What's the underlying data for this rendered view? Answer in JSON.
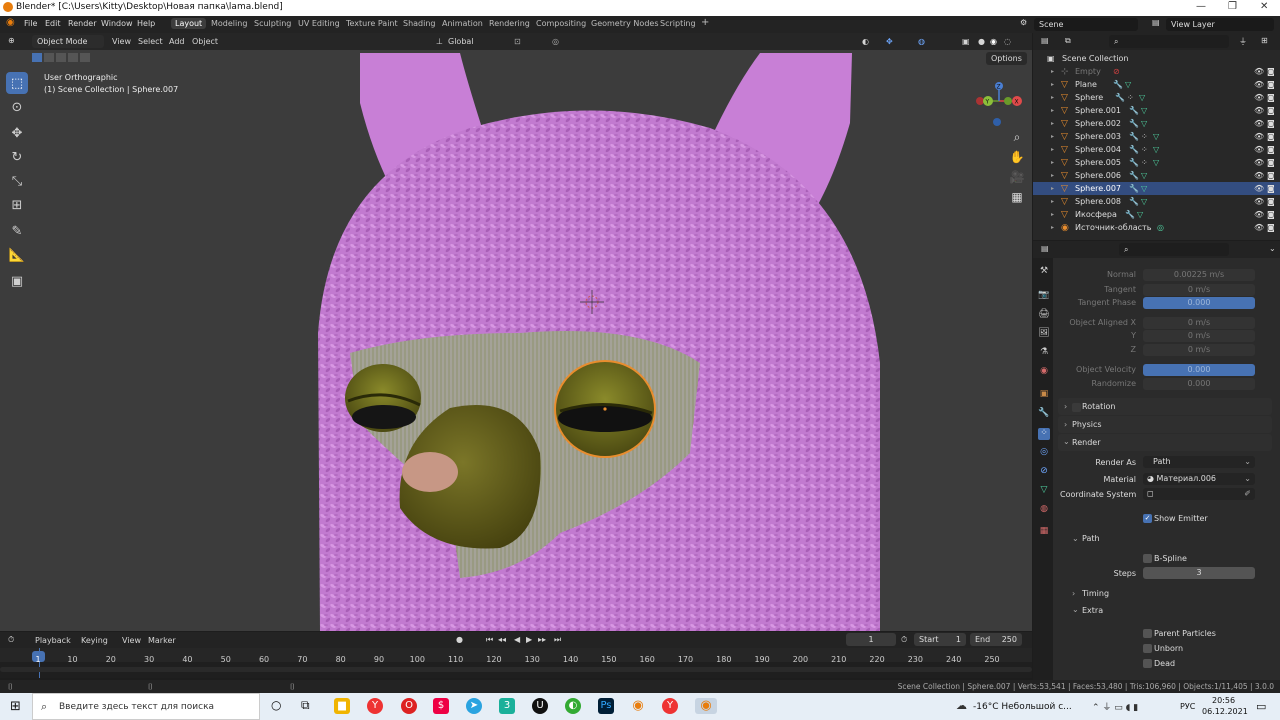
{
  "window": {
    "title": "Blender* [C:\\Users\\Kitty\\Desktop\\Новая папка\\lama.blend]",
    "controls": [
      "—",
      "❐",
      "✕"
    ]
  },
  "menu": [
    "File",
    "Edit",
    "Render",
    "Window",
    "Help"
  ],
  "workspaces": {
    "active": "Layout",
    "tabs": [
      "Modeling",
      "Sculpting",
      "UV Editing",
      "Texture Paint",
      "Shading",
      "Animation",
      "Rendering",
      "Compositing",
      "Geometry Nodes",
      "Scripting"
    ],
    "add": "+"
  },
  "scene": {
    "label": "Scene",
    "view_layer": "View Layer"
  },
  "viewport_header": {
    "mode": "Object Mode",
    "menus": [
      "View",
      "Select",
      "Add",
      "Object"
    ],
    "transform": "Global",
    "options": "Options"
  },
  "viewport": {
    "view_name": "User Orthographic",
    "collection_info": "(1) Scene Collection | Sphere.007",
    "gizmo": {
      "x": "X",
      "y": "Y",
      "z": "Z"
    }
  },
  "tools": [
    "select-box-tool",
    "cursor-tool",
    "move-tool",
    "rotate-tool",
    "scale-tool",
    "transform-tool",
    "annotate-tool",
    "measure-tool",
    "add-cube-tool"
  ],
  "outliner": {
    "root": "Scene Collection",
    "items": [
      {
        "name": "Empty",
        "dim": true
      },
      {
        "name": "Plane"
      },
      {
        "name": "Sphere"
      },
      {
        "name": "Sphere.001"
      },
      {
        "name": "Sphere.002"
      },
      {
        "name": "Sphere.003"
      },
      {
        "name": "Sphere.004"
      },
      {
        "name": "Sphere.005"
      },
      {
        "name": "Sphere.006"
      },
      {
        "name": "Sphere.007",
        "selected": true
      },
      {
        "name": "Sphere.008"
      },
      {
        "name": "Икосфера"
      },
      {
        "name": "Источник-область"
      }
    ]
  },
  "properties": {
    "velocity": {
      "normal_label": "Normal",
      "normal": "0.00225 m/s",
      "tangent_label": "Tangent",
      "tangent": "0 m/s",
      "tangent_phase_label": "Tangent Phase",
      "tangent_phase": "0.000",
      "obj_aligned_label": "Object Aligned X",
      "obj_x": "0 m/s",
      "y_label": "Y",
      "obj_y": "0 m/s",
      "z_label": "Z",
      "obj_z": "0 m/s",
      "obj_velocity_label": "Object Velocity",
      "obj_velocity": "0.000",
      "randomize_label": "Randomize",
      "randomize": "0.000"
    },
    "sections": {
      "rotation": "Rotation",
      "physics": "Physics",
      "render": "Render",
      "path": "Path",
      "timing": "Timing",
      "extra": "Extra"
    },
    "render": {
      "render_as_label": "Render As",
      "render_as": "Path",
      "material_label": "Material",
      "material": "Материал.006",
      "coord_label": "Coordinate System",
      "show_emitter": "Show Emitter"
    },
    "path": {
      "bspline": "B-Spline",
      "steps_label": "Steps",
      "steps": "3"
    },
    "extra": {
      "parent_particles": "Parent Particles",
      "unborn": "Unborn",
      "dead": "Dead"
    }
  },
  "timeline": {
    "menus": [
      "Playback",
      "Keying",
      "View",
      "Marker"
    ],
    "current_frame": "1",
    "start_label": "Start",
    "start": "1",
    "end_label": "End",
    "end": "250",
    "ticks": [
      "1",
      "10",
      "20",
      "30",
      "40",
      "50",
      "60",
      "70",
      "80",
      "90",
      "100",
      "110",
      "120",
      "130",
      "140",
      "150",
      "160",
      "170",
      "180",
      "190",
      "200",
      "210",
      "220",
      "230",
      "240",
      "250"
    ]
  },
  "statusbar": "Scene Collection | Sphere.007 | Verts:53,541 | Faces:53,480 | Tris:106,960 | Objects:1/11,405 | 3.0.0",
  "taskbar": {
    "search_placeholder": "Введите здесь текст для поиска",
    "weather": "-16°C Небольшой с...",
    "lang": "РУС",
    "time": "20:56",
    "date": "06.12.2021"
  },
  "colors": {
    "accent": "#4772b3",
    "select_orange": "#e88d2e",
    "fur": "#c77ad6",
    "face": "#6f6a1f"
  }
}
